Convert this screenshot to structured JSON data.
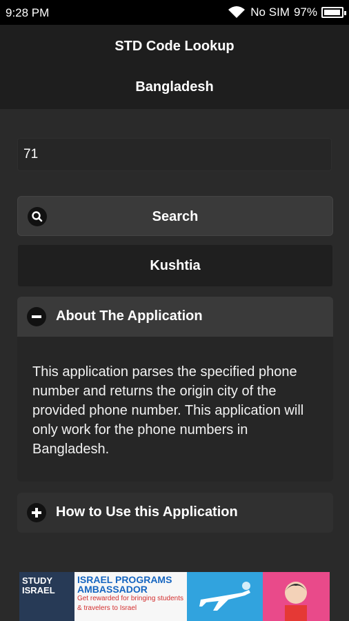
{
  "status_bar": {
    "time": "9:28 PM",
    "carrier": "No SIM",
    "battery": "97%",
    "battery_level": 0.97
  },
  "header": {
    "title": "STD Code Lookup",
    "subtitle": "Bangladesh"
  },
  "input": {
    "value": "71"
  },
  "search": {
    "label": "Search",
    "icon": "search-icon"
  },
  "result": {
    "label": "Kushtia"
  },
  "about": {
    "title": "About The Application",
    "icon": "minus-icon",
    "body": "This application parses the specified phone number and returns the origin city of the provided phone number. This application will only work for the phone numbers in Bangladesh."
  },
  "howto": {
    "title": "How to Use this Application",
    "icon": "plus-icon"
  },
  "ad": {
    "study": "STUDY ISRAEL",
    "programs": "ISRAEL PROGRAMS AMBASSADOR",
    "tagline": "Get rewarded for bringing students & travelers to Israel"
  },
  "colors": {
    "background": "#2a2a2a",
    "header": "#1e1e1e",
    "button": "#3a3a3a"
  }
}
